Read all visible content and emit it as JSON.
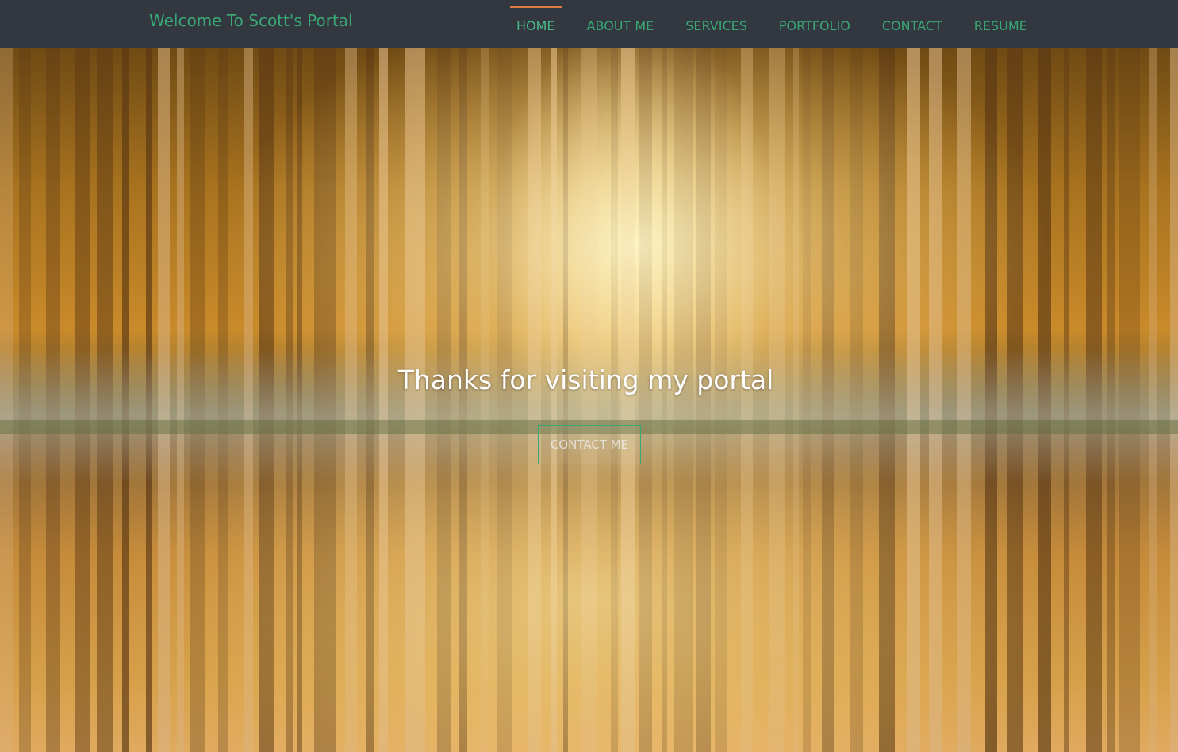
{
  "header": {
    "brand": "Welcome To Scott's Portal",
    "nav": [
      {
        "label": "HOME",
        "active": true
      },
      {
        "label": "ABOUT ME",
        "active": false
      },
      {
        "label": "SERVICES",
        "active": false
      },
      {
        "label": "PORTFOLIO",
        "active": false
      },
      {
        "label": "CONTACT",
        "active": false
      },
      {
        "label": "RESUME",
        "active": false
      }
    ]
  },
  "hero": {
    "background_image": "misty-forest-reflection-photo",
    "headline": "Thanks for visiting my portal",
    "cta_label": "CONTACT ME"
  },
  "colors": {
    "navbar_bg": "#323740",
    "accent_green": "#3aa874",
    "active_indicator": "#e0793c",
    "headline_text": "#ffffff"
  }
}
